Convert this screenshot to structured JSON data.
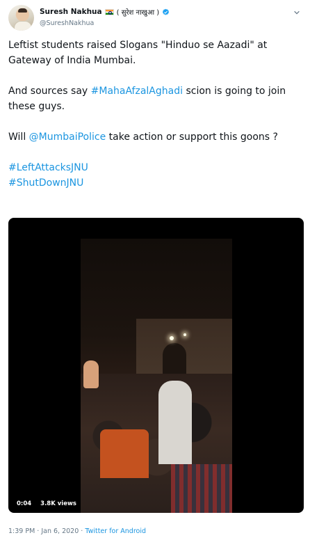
{
  "user": {
    "name": "Suresh Nakhua",
    "flag_emoji": "🇮🇳",
    "alt_name": "( सुरेश नाखुआ )",
    "handle": "@SureshNakhua",
    "verified": true
  },
  "tweet": {
    "line1": "Leftist students raised Slogans \"Hinduo se Aazadi\" at Gateway of India Mumbai.",
    "line2_prefix": "And sources say ",
    "line2_hashtag": "#MahaAfzalAghadi",
    "line2_suffix": " scion is going to join these guys.",
    "line3_prefix": "Will ",
    "line3_mention": "@MumbaiPolice",
    "line3_suffix": " take action or support this goons ?",
    "hashtag1": "#LeftAttacksJNU",
    "hashtag2": "#ShutDownJNU"
  },
  "media": {
    "duration": "0:04",
    "views": "3.8K views"
  },
  "footer": {
    "time": "1:39 PM",
    "separator": " · ",
    "date": "Jan 6, 2020",
    "source": "Twitter for Android"
  },
  "icons": {
    "verified": "verified-badge-icon",
    "more": "chevron-down-icon"
  },
  "colors": {
    "link": "#1b95e0",
    "muted": "#657786",
    "verified": "#1da1f2"
  }
}
